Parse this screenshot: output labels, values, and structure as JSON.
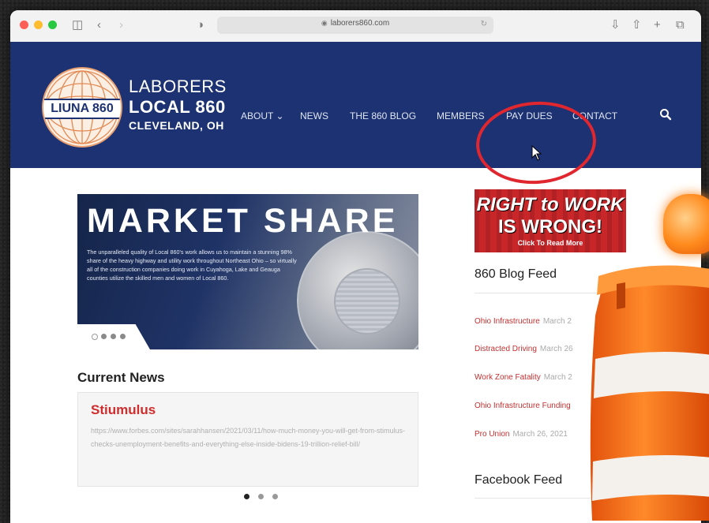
{
  "browser": {
    "address": "laborers860.com",
    "traffic_lights": [
      "#ff5f57",
      "#febc2e",
      "#28c840"
    ]
  },
  "site": {
    "logo_text": "LIUNA 860",
    "brand_line1": "LABORERS",
    "brand_line2": "LOCAL 860",
    "brand_line3": "CLEVELAND, OH",
    "colors": {
      "header_bg": "#1d3272",
      "accent_red": "#d02c2c",
      "annotation_circle": "#e0262e"
    }
  },
  "nav": {
    "items": [
      {
        "label": "ABOUT ⌄"
      },
      {
        "label": "NEWS"
      },
      {
        "label": "THE 860 BLOG"
      },
      {
        "label": "MEMBERS"
      },
      {
        "label": "PAY DUES"
      },
      {
        "label": "CONTACT"
      }
    ],
    "search_icon": "search-icon"
  },
  "hero": {
    "title": "MARKET SHARE",
    "body": "The unparalleled quality of Local 860's work allows us to maintain a stunning 98% share of the heavy highway and utility work throughout Northeast Ohio – so virtually all of the construction companies doing work in Cuyahoga, Lake and Geauga counties utilize the skilled men and women of Local 860.",
    "slide_count": 4,
    "active_slide": 0
  },
  "current_news": {
    "heading": "Current News",
    "post_title": "Stiumulus",
    "post_url": "https://www.forbes.com/sites/sarahhansen/2021/03/11/how-much-money-you-will-get-from-stimulus-checks-unemployment-benefits-and-everything-else-inside-bidens-19-trillion-relief-bill/",
    "pager_count": 3,
    "pager_active": 0
  },
  "sidebar": {
    "banner_line1": "RIGHT to WORK",
    "banner_line2": "IS WRONG!",
    "banner_line3": "Click To Read More",
    "blog_heading": "860 Blog Feed",
    "feed": [
      {
        "title": "Ohio Infrastructure",
        "date": "March 2"
      },
      {
        "title": "Distracted Driving",
        "date": "March 26"
      },
      {
        "title": "Work Zone Fatality",
        "date": "March 2"
      },
      {
        "title": "Ohio Infrastructure Funding",
        "date": ""
      },
      {
        "title": "Pro Union",
        "date": "March 26, 2021"
      }
    ],
    "facebook_heading": "Facebook Feed"
  }
}
